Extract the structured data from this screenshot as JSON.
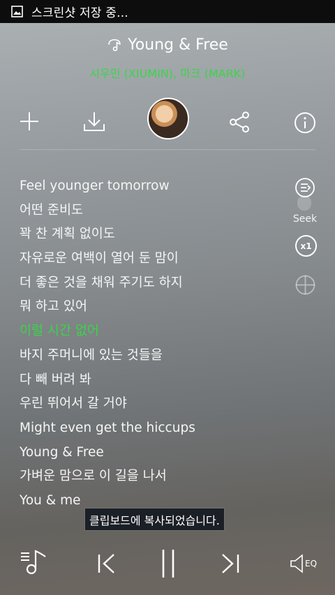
{
  "status_bar": {
    "text": "스크린샷 저장 중..."
  },
  "song": {
    "title": "Young & Free",
    "artist": "시우민 (XIUMIN), 마크 (MARK)"
  },
  "toolbar": {
    "icons": [
      "plus-icon",
      "download-icon",
      "album-art",
      "share-icon",
      "info-icon"
    ]
  },
  "lyrics": {
    "current_index": 6,
    "lines": [
      "Feel younger tomorrow",
      "어떤 준비도",
      "꽉 찬 계획 없이도",
      "자유로운 여백이 열어 둔 맘이",
      "더 좋은 것을 채워 주기도 하지",
      "뭐 하고 있어",
      "이럴 시간 없어",
      "바지 주머니에 있는 것들을",
      "다 빼 버려 봐",
      "우린 뛰어서 갈 거야",
      "Might even get the hiccups",
      "Young & Free",
      "가벼운 맘으로 이 길을 나서",
      "You & me"
    ]
  },
  "side_controls": {
    "seek_label": "Seek",
    "speed_label": "x1"
  },
  "toast": {
    "text": "클립보드에 복사되었습니다."
  },
  "player": {
    "eq_label": "EQ"
  },
  "colors": {
    "accent": "#39d54a",
    "statusbar": "#0d0d0d",
    "toast_bg": "#1b1f26"
  }
}
